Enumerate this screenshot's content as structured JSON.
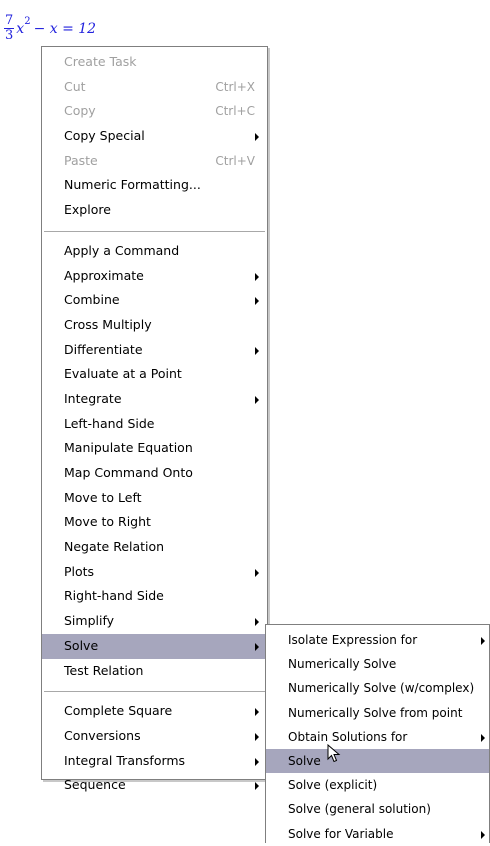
{
  "equation": {
    "numerator": "7",
    "denominator": "3",
    "variable": "x",
    "exponent": "2",
    "rest": " − x = 12"
  },
  "colors": {
    "equation": "#2222dd",
    "highlight": "#a6a6bd",
    "disabled": "#a0a0a0"
  },
  "main_menu": {
    "group1": [
      {
        "label": "Create Task",
        "disabled": true
      },
      {
        "label": "Cut",
        "disabled": true,
        "shortcut": "Ctrl+X"
      },
      {
        "label": "Copy",
        "disabled": true,
        "shortcut": "Ctrl+C"
      },
      {
        "label": "Copy Special",
        "submenu": true
      },
      {
        "label": "Paste",
        "disabled": true,
        "shortcut": "Ctrl+V"
      },
      {
        "label": "Numeric Formatting..."
      },
      {
        "label": "Explore"
      }
    ],
    "group2": [
      {
        "label": "Apply a Command"
      },
      {
        "label": "Approximate",
        "submenu": true
      },
      {
        "label": "Combine",
        "submenu": true
      },
      {
        "label": "Cross Multiply"
      },
      {
        "label": "Differentiate",
        "submenu": true
      },
      {
        "label": "Evaluate at a Point"
      },
      {
        "label": "Integrate",
        "submenu": true
      },
      {
        "label": "Left-hand Side"
      },
      {
        "label": "Manipulate Equation"
      },
      {
        "label": "Map Command Onto"
      },
      {
        "label": "Move to Left"
      },
      {
        "label": "Move to Right"
      },
      {
        "label": "Negate Relation"
      },
      {
        "label": "Plots",
        "submenu": true
      },
      {
        "label": "Right-hand Side"
      },
      {
        "label": "Simplify",
        "submenu": true
      },
      {
        "label": "Solve",
        "submenu": true,
        "highlighted": true
      },
      {
        "label": "Test Relation"
      }
    ],
    "group3": [
      {
        "label": "Complete Square",
        "submenu": true
      },
      {
        "label": "Conversions",
        "submenu": true
      },
      {
        "label": "Integral Transforms",
        "submenu": true
      },
      {
        "label": "Sequence",
        "submenu": true
      }
    ]
  },
  "solve_submenu": [
    {
      "label": "Isolate Expression for",
      "submenu": true
    },
    {
      "label": "Numerically Solve"
    },
    {
      "label": "Numerically Solve (w/complex)"
    },
    {
      "label": "Numerically Solve from point"
    },
    {
      "label": "Obtain Solutions for",
      "submenu": true
    },
    {
      "label": "Solve",
      "highlighted": true
    },
    {
      "label": "Solve (explicit)"
    },
    {
      "label": "Solve (general solution)"
    },
    {
      "label": "Solve for Variable",
      "submenu": true
    }
  ],
  "cursor_icon": "arrow-pointer-icon"
}
